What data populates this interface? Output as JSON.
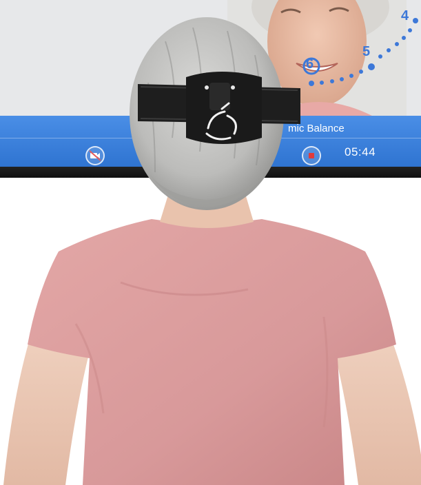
{
  "screen": {
    "title_text": "mic Balance",
    "timer": "05:44",
    "target_numbers": [
      "4",
      "5",
      "6"
    ]
  },
  "icons": {
    "video_toggle": "video-off-icon",
    "record_stop": "stop-icon",
    "sensor_logo": "swirl-logo-icon"
  },
  "colors": {
    "accent_blue": "#3d78d8",
    "bar_blue": "#2f74d1",
    "shirt_pink": "#d99a9a",
    "headband": "#1b1b1b",
    "hair": "#c9c9c7"
  }
}
